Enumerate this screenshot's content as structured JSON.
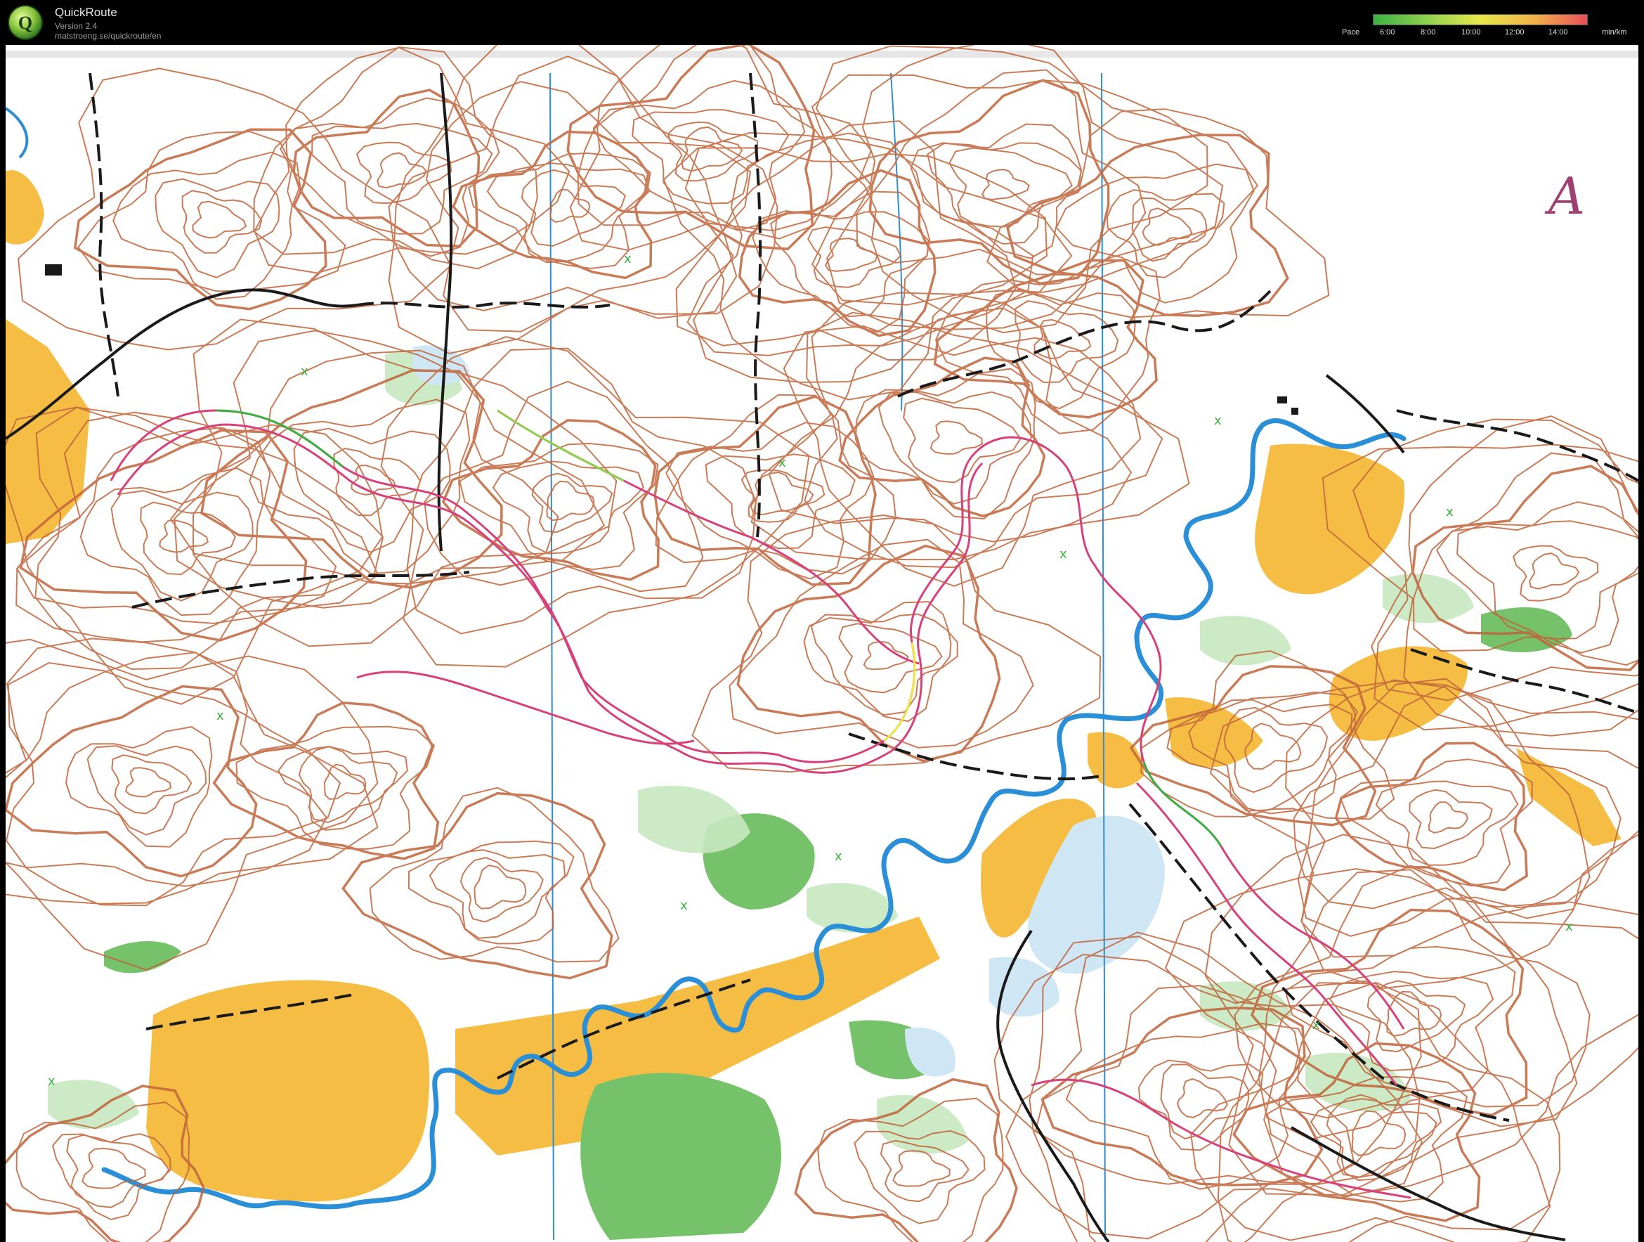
{
  "app": {
    "title": "QuickRoute",
    "version": "Version 2.4",
    "url": "matstroeng.se/quickroute/en",
    "logo_letter": "Q"
  },
  "pace_legend": {
    "label": "Pace",
    "unit": "min/km",
    "ticks": [
      "6:00",
      "8:00",
      "10:00",
      "12:00",
      "14:00"
    ],
    "gradient_colors": [
      "#3cb043",
      "#8fd14f",
      "#e8e84a",
      "#f2b24a",
      "#e8505a"
    ]
  },
  "map": {
    "annotation_mark": "A",
    "colors": {
      "paper": "#ffffff",
      "open_land": "#f6b93b",
      "green": "#76c26a",
      "light_green": "#c8e8c0",
      "water": "#2a8fd6",
      "contour": "#c0643a",
      "route": "#d8407a",
      "track": "#1a1a1a"
    }
  }
}
